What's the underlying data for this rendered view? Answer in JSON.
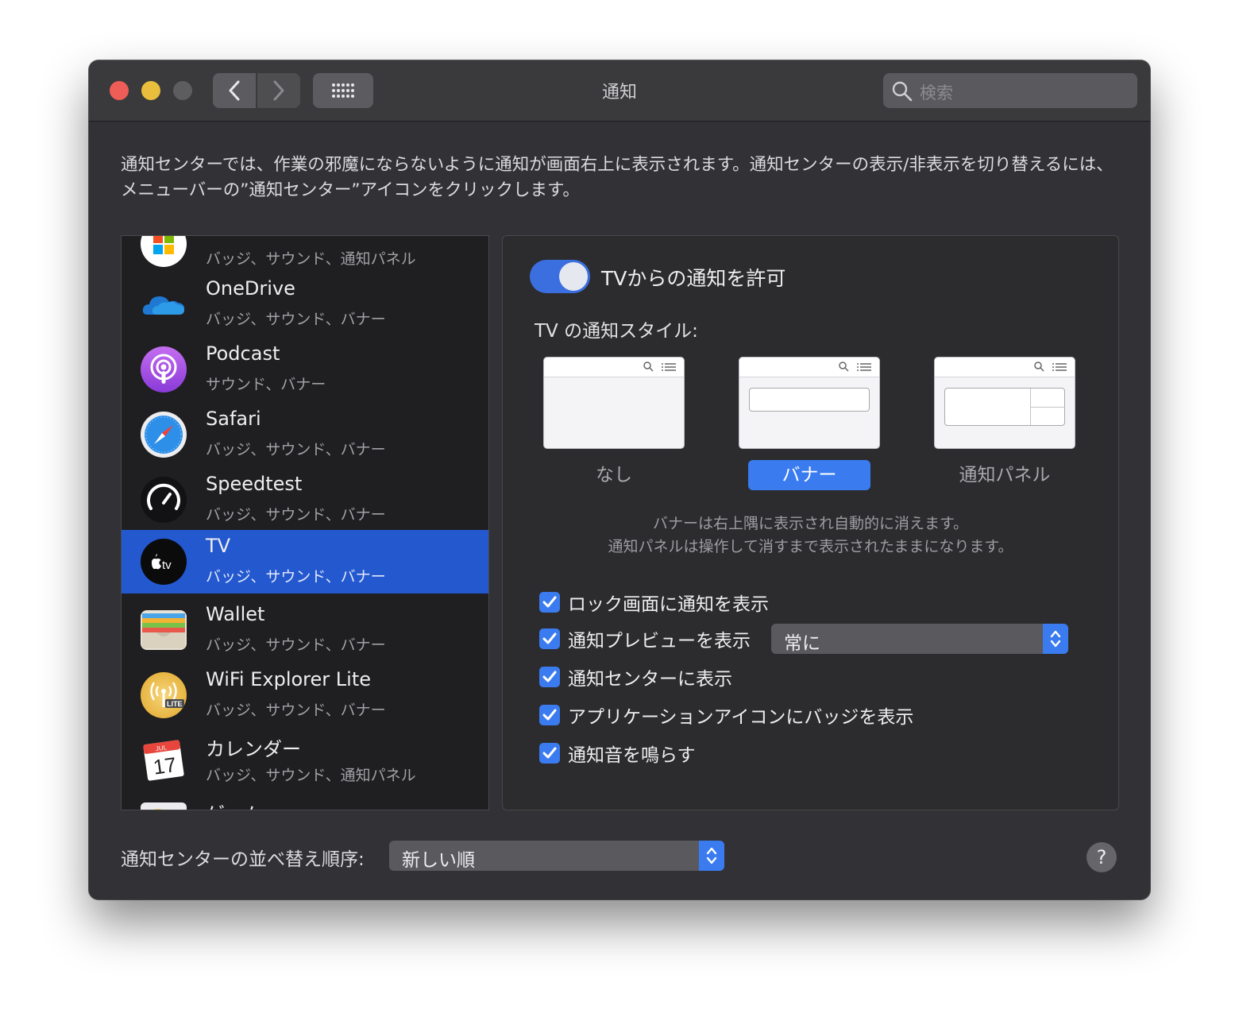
{
  "window": {
    "title": "通知"
  },
  "search": {
    "placeholder": "検索"
  },
  "description": "通知センターでは、作業の邪魔にならないように通知が画面右上に表示されます。通知センターの表示/非表示を切り替えるには、メニューバーの”通知センター”アイコンをクリックします。",
  "apps": [
    {
      "name": "",
      "subtitle": "バッジ、サウンド、通知パネル",
      "icon": "microsoft-icon"
    },
    {
      "name": "OneDrive",
      "subtitle": "バッジ、サウンド、バナー",
      "icon": "onedrive-icon"
    },
    {
      "name": "Podcast",
      "subtitle": "サウンド、バナー",
      "icon": "podcast-icon"
    },
    {
      "name": "Safari",
      "subtitle": "バッジ、サウンド、バナー",
      "icon": "safari-icon"
    },
    {
      "name": "Speedtest",
      "subtitle": "バッジ、サウンド、バナー",
      "icon": "speedtest-icon"
    },
    {
      "name": "TV",
      "subtitle": "バッジ、サウンド、バナー",
      "icon": "apple-tv-icon",
      "selected": true
    },
    {
      "name": "Wallet",
      "subtitle": "バッジ、サウンド、バナー",
      "icon": "wallet-icon"
    },
    {
      "name": "WiFi Explorer Lite",
      "subtitle": "バッジ、サウンド、バナー",
      "icon": "wifi-explorer-icon"
    },
    {
      "name": "カレンダー",
      "subtitle": "バッジ、サウンド、通知パネル",
      "icon": "calendar-icon"
    },
    {
      "name": "ゲーム",
      "subtitle": "",
      "icon": "game-center-icon"
    }
  ],
  "icon_text": {
    "tv": "tv",
    "calendar_month": "JUL",
    "calendar_day": "17",
    "lite": "LITE"
  },
  "detail": {
    "allow_label": "TVからの通知を許可",
    "allow_enabled": true,
    "style_label": "TV の通知スタイル:",
    "styles": [
      {
        "label": "なし",
        "selected": false
      },
      {
        "label": "バナー",
        "selected": true
      },
      {
        "label": "通知パネル",
        "selected": false
      }
    ],
    "help_line1": "バナーは右上隅に表示され自動的に消えます。",
    "help_line2": "通知パネルは操作して消すまで表示されたままになります。",
    "options": [
      {
        "label": "ロック画面に通知を表示",
        "checked": true
      },
      {
        "label": "通知プレビューを表示",
        "checked": true
      },
      {
        "label": "通知センターに表示",
        "checked": true
      },
      {
        "label": "アプリケーションアイコンにバッジを表示",
        "checked": true
      },
      {
        "label": "通知音を鳴らす",
        "checked": true
      }
    ],
    "preview_select": "常に"
  },
  "footer": {
    "sort_label": "通知センターの並べ替え順序:",
    "sort_value": "新しい順",
    "help": "?"
  },
  "colors": {
    "accent": "#3a7bf0",
    "selection": "#2358cf",
    "window_bg": "#323236"
  }
}
